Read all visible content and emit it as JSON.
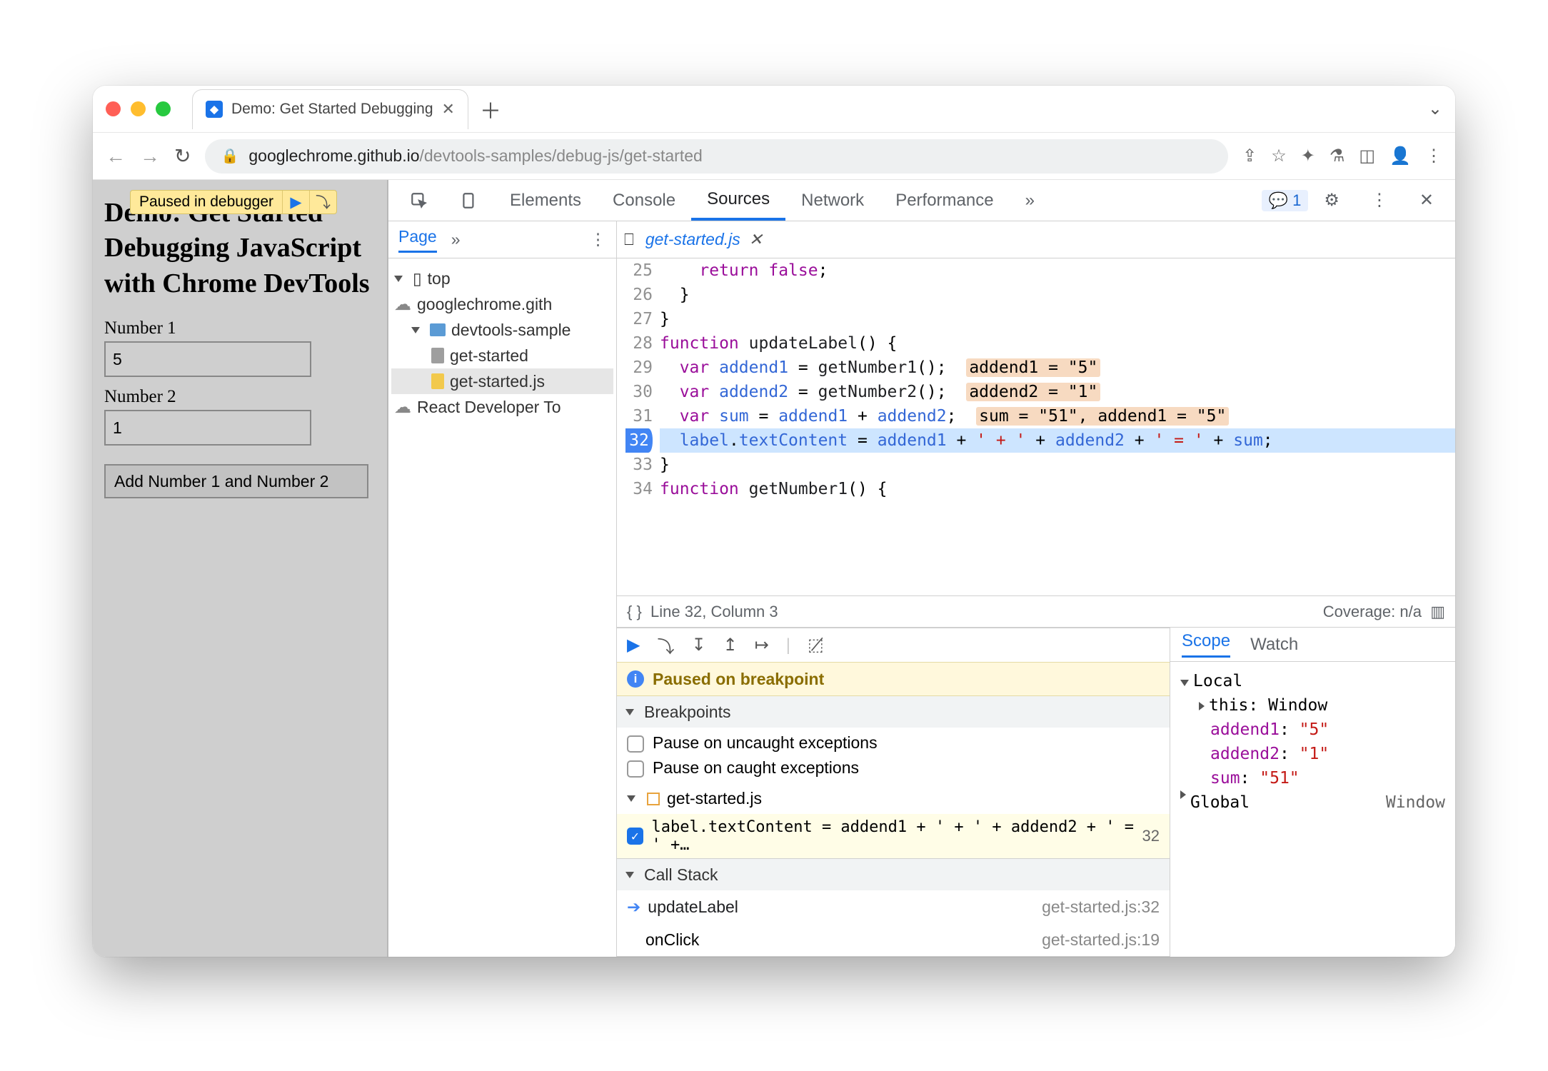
{
  "browser": {
    "tab_title": "Demo: Get Started Debugging",
    "url_host": "googlechrome.github.io",
    "url_path": "/devtools-samples/debug-js/get-started"
  },
  "overlay": {
    "text": "Paused in debugger"
  },
  "page": {
    "heading": "Demo: Get Started Debugging JavaScript with Chrome DevTools",
    "label1": "Number 1",
    "value1": "5",
    "label2": "Number 2",
    "value2": "1",
    "button": "Add Number 1 and Number 2"
  },
  "devtools": {
    "panels": [
      "Elements",
      "Console",
      "Sources",
      "Network",
      "Performance"
    ],
    "active_panel": "Sources",
    "messages_count": "1",
    "nav_tab": "Page",
    "tree": {
      "top": "top",
      "origin": "googlechrome.gith",
      "folder": "devtools-sample",
      "file_html": "get-started",
      "file_js": "get-started.js",
      "ext": "React Developer To"
    },
    "open_file": "get-started.js",
    "code": {
      "lines": [
        {
          "n": "25",
          "text": "    return false;"
        },
        {
          "n": "26",
          "text": "  }"
        },
        {
          "n": "27",
          "text": "}"
        },
        {
          "n": "28",
          "text": "function updateLabel() {"
        },
        {
          "n": "29",
          "text": "  var addend1 = getNumber1();",
          "hint": "addend1 = \"5\""
        },
        {
          "n": "30",
          "text": "  var addend2 = getNumber2();",
          "hint": "addend2 = \"1\""
        },
        {
          "n": "31",
          "text": "  var sum = addend1 + addend2;",
          "hint": "sum = \"51\", addend1 = \"5\""
        },
        {
          "n": "32",
          "text": "  label.textContent = addend1 + ' + ' + addend2 + ' = ' + sum;",
          "bp": true
        },
        {
          "n": "33",
          "text": "}"
        },
        {
          "n": "34",
          "text": "function getNumber1() {"
        }
      ]
    },
    "status": {
      "pos": "Line 32, Column 3",
      "coverage": "Coverage: n/a"
    },
    "paused_msg": "Paused on breakpoint",
    "sections": {
      "breakpoints": "Breakpoints",
      "pause_uncaught": "Pause on uncaught exceptions",
      "pause_caught": "Pause on caught exceptions",
      "bp_file": "get-started.js",
      "bp_code": "label.textContent = addend1 + ' + ' + addend2 + ' = ' +…",
      "bp_line": "32",
      "callstack": "Call Stack",
      "cs": [
        {
          "fn": "updateLabel",
          "loc": "get-started.js:32",
          "active": true
        },
        {
          "fn": "onClick",
          "loc": "get-started.js:19"
        }
      ]
    },
    "scope": {
      "tabs": [
        "Scope",
        "Watch"
      ],
      "local": "Local",
      "this": "this: Window",
      "vars": [
        {
          "k": "addend1",
          "v": "\"5\""
        },
        {
          "k": "addend2",
          "v": "\"1\""
        },
        {
          "k": "sum",
          "v": "\"51\""
        }
      ],
      "global": "Global",
      "global_v": "Window"
    }
  }
}
